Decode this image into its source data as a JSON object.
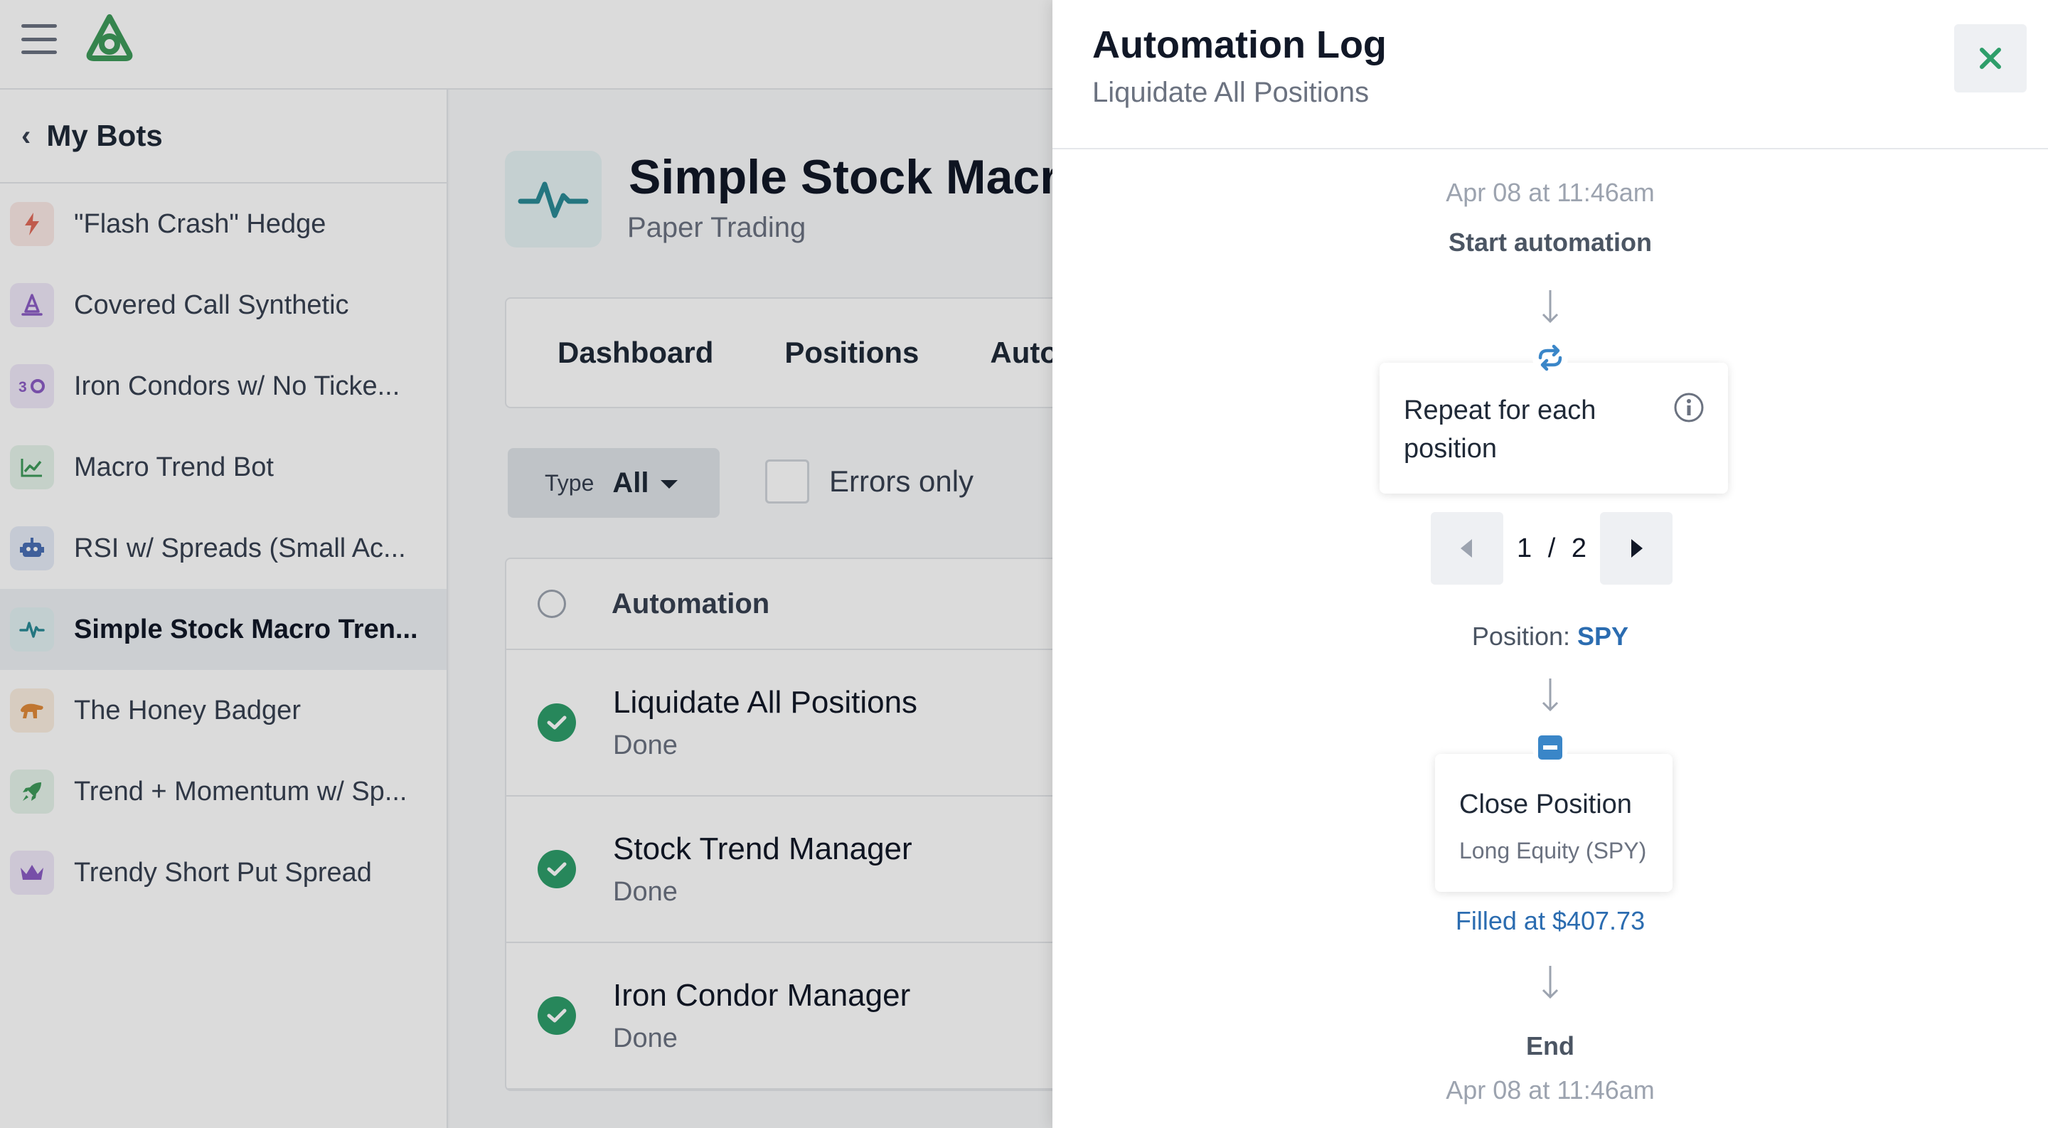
{
  "sidebar": {
    "back_label": "My Bots",
    "items": [
      {
        "label": "\"Flash Crash\" Hedge",
        "icon": "lightning-icon",
        "color": "#e06b5a",
        "bg": "#fbe9e6"
      },
      {
        "label": "Covered Call Synthetic",
        "icon": "wizard-hat-icon",
        "color": "#8b5cc4",
        "bg": "#efe8f8"
      },
      {
        "label": "Iron Condors w/ No Ticke...",
        "icon": "iron-condor-icon",
        "color": "#8b5cc4",
        "bg": "#efe8f8"
      },
      {
        "label": "Macro Trend Bot",
        "icon": "line-chart-icon",
        "color": "#3e9a5a",
        "bg": "#e6f4ea"
      },
      {
        "label": "RSI w/ Spreads (Small Ac...",
        "icon": "robot-icon",
        "color": "#4a6fb5",
        "bg": "#e6ecf7"
      },
      {
        "label": "Simple Stock Macro Tren...",
        "icon": "pulse-icon",
        "color": "#2a8a96",
        "bg": "#e2f1f3"
      },
      {
        "label": "The Honey Badger",
        "icon": "badger-icon",
        "color": "#e08a3a",
        "bg": "#fbeee0"
      },
      {
        "label": "Trend + Momentum w/ Sp...",
        "icon": "rocket-icon",
        "color": "#3e9a5a",
        "bg": "#e6f4ea"
      },
      {
        "label": "Trendy Short Put Spread",
        "icon": "crown-icon",
        "color": "#8b5cc4",
        "bg": "#efe8f8"
      }
    ]
  },
  "main": {
    "bot_title": "Simple Stock Macro Trend",
    "bot_subtitle": "Paper Trading",
    "tabs": [
      "Dashboard",
      "Positions",
      "Automations"
    ],
    "filter": {
      "key": "Type",
      "value": "All"
    },
    "errors_only_label": "Errors only",
    "table_header": "Automation",
    "rows": [
      {
        "name": "Liquidate All Positions",
        "status": "Done"
      },
      {
        "name": "Stock Trend Manager",
        "status": "Done"
      },
      {
        "name": "Iron Condor Manager",
        "status": "Done"
      }
    ]
  },
  "drawer": {
    "title": "Automation Log",
    "subtitle": "Liquidate All Positions",
    "start_time": "Apr 08 at 11:46am",
    "start_label": "Start automation",
    "repeat_label": "Repeat for each position",
    "pager": {
      "current": "1",
      "sep": "/",
      "total": "2"
    },
    "position_prefix": "Position:",
    "position_symbol": "SPY",
    "close_title": "Close Position",
    "close_sub": "Long Equity (SPY)",
    "filled_text": "Filled at $407.73",
    "end_label": "End",
    "end_time": "Apr 08 at 11:46am"
  },
  "colors": {
    "accent_green": "#2e9e6a",
    "link_blue": "#2b6cb0",
    "logo_green": "#3e9a5a"
  }
}
